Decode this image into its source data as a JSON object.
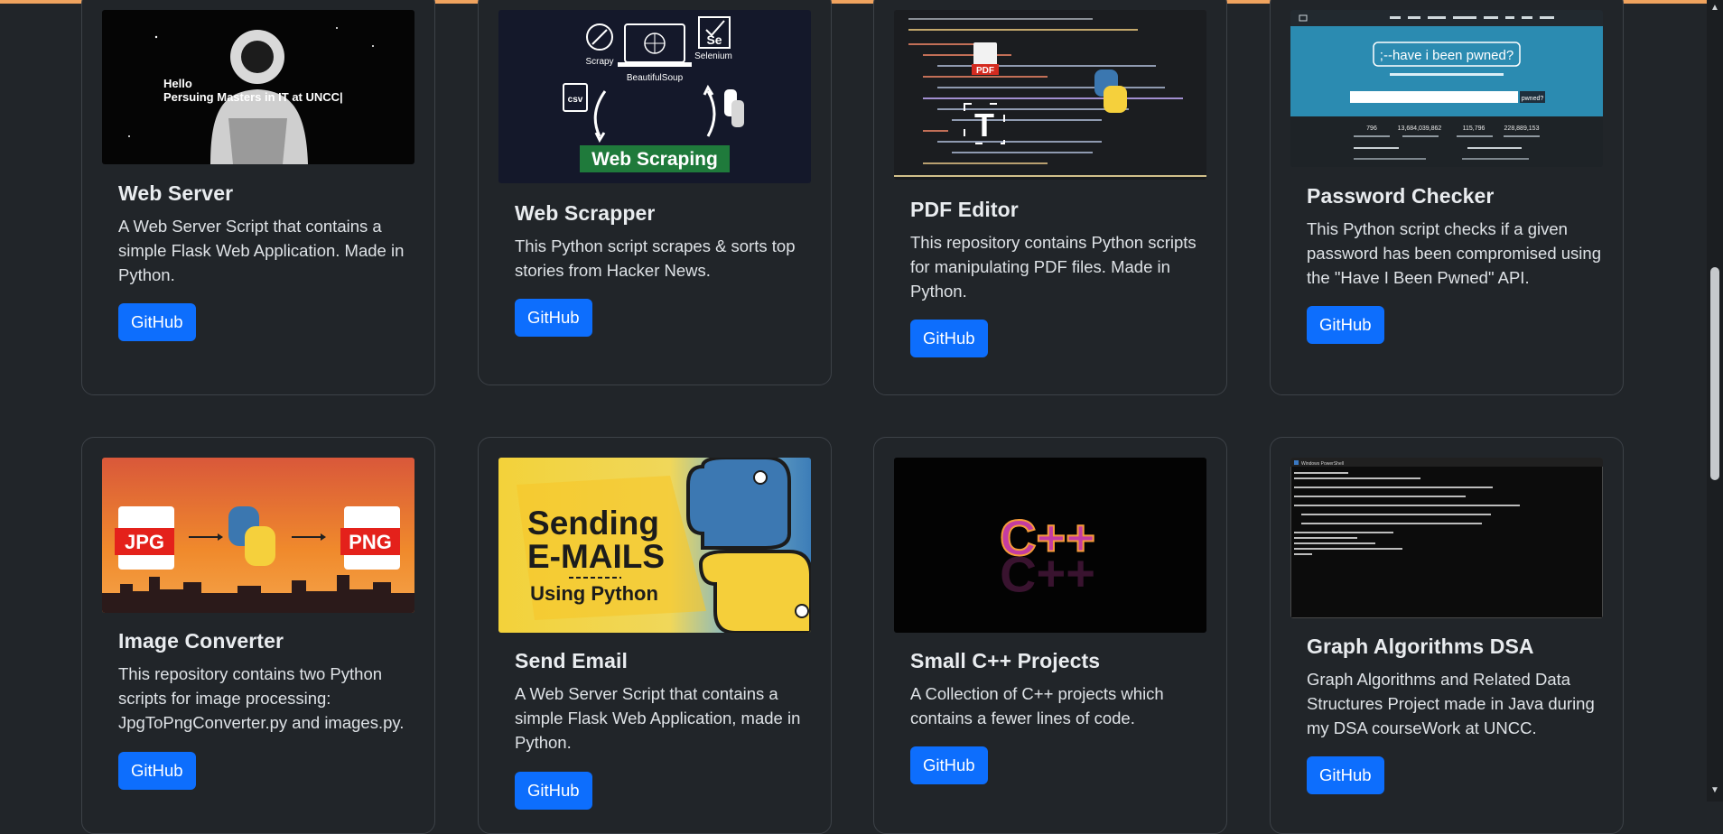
{
  "projects": [
    {
      "title": "Web Server",
      "description": "A Web Server Script that contains a simple Flask Web Application. Made in Python.",
      "button": "GitHub",
      "image_text": [
        "Hello",
        "Persuing Masters in IT at UNCC|"
      ]
    },
    {
      "title": "Web Scrapper",
      "description": "This Python script scrapes & sorts top stories from Hacker News.",
      "button": "GitHub",
      "image_text": [
        "Scrapy",
        "Selenium",
        "Se",
        "BeautifulSoup",
        "csv",
        "Web Scraping"
      ]
    },
    {
      "title": "PDF Editor",
      "description": "This repository contains Python scripts for manipulating PDF files. Made in Python.",
      "button": "GitHub",
      "image_text": [
        "PDF",
        "T"
      ]
    },
    {
      "title": "Password Checker",
      "description": "This Python script checks if a given password has been compromised using the \"Have I Been Pwned\" API.",
      "button": "GitHub",
      "image_text": [
        ";--have i been pwned?",
        "pwned?",
        "796",
        "13,684,039,862",
        "115,796",
        "228,889,153"
      ]
    },
    {
      "title": "Image Converter",
      "description": "This repository contains two Python scripts for image processing: JpgToPngConverter.py and images.py.",
      "button": "GitHub",
      "image_text": [
        "JPG",
        "PNG"
      ]
    },
    {
      "title": "Send Email",
      "description": "A Web Server Script that contains a simple Flask Web Application, made in Python.",
      "button": "GitHub",
      "image_text": [
        "Sending",
        "E-MAILS",
        "Using Python"
      ]
    },
    {
      "title": "Small C++ Projects",
      "description": "A Collection of C++ projects which contains a fewer lines of code.",
      "button": "GitHub",
      "image_text": [
        "C++"
      ]
    },
    {
      "title": "Graph Algorithms DSA",
      "description": "Graph Algorithms and Related Data Structures Project made in Java during my DSA courseWork at UNCC.",
      "button": "GitHub",
      "image_text": [
        "Windows PowerShell"
      ]
    }
  ],
  "colors": {
    "page_bg": "#212529",
    "card_border": "#3d4248",
    "button_bg": "#0d6efd",
    "top_accent": "#f0a35e"
  }
}
